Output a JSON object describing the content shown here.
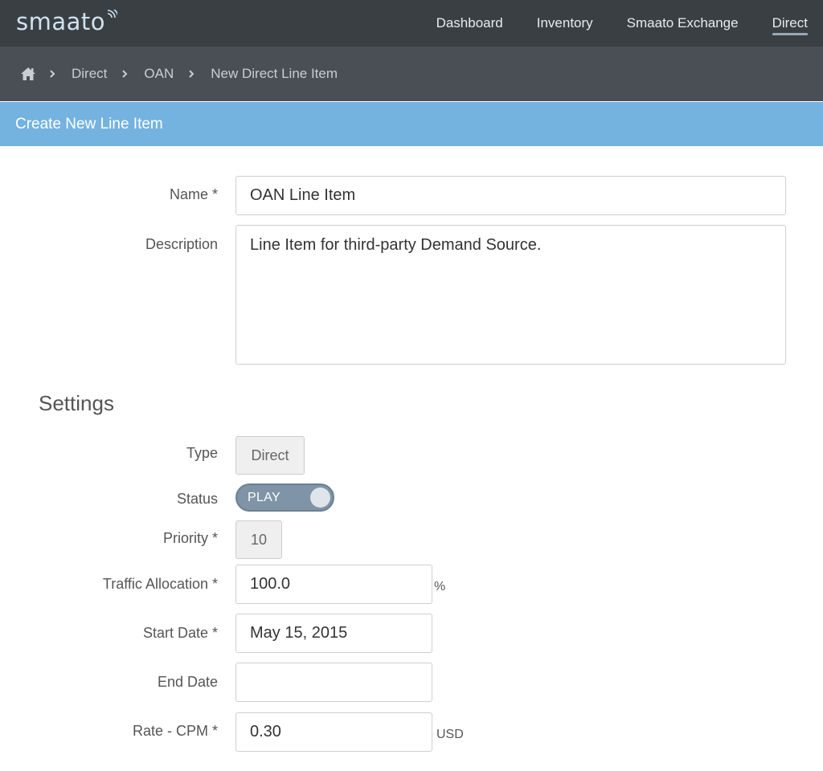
{
  "brand": {
    "logo_text": "smaato"
  },
  "nav": {
    "items": [
      {
        "label": "Dashboard"
      },
      {
        "label": "Inventory"
      },
      {
        "label": "Smaato Exchange"
      },
      {
        "label": "Direct"
      }
    ],
    "active": "Direct"
  },
  "breadcrumb": {
    "items": [
      "Direct",
      "OAN",
      "New Direct Line Item"
    ]
  },
  "panel": {
    "title": "Create New Line Item"
  },
  "form": {
    "name": {
      "label": "Name *",
      "value": "OAN Line Item"
    },
    "description": {
      "label": "Description",
      "value": "Line Item for third-party Demand Source."
    },
    "settings_title": "Settings",
    "type": {
      "label": "Type",
      "value": "Direct"
    },
    "status": {
      "label": "Status",
      "value": "PLAY",
      "on": true
    },
    "priority": {
      "label": "Priority *",
      "value": "10"
    },
    "traffic_allocation": {
      "label": "Traffic Allocation *",
      "value": "100.0",
      "unit": "%"
    },
    "start_date": {
      "label": "Start Date *",
      "value": "May 15, 2015"
    },
    "end_date": {
      "label": "End Date",
      "value": ""
    },
    "rate_cpm": {
      "label": "Rate - CPM *",
      "value": "0.30",
      "unit": "USD"
    }
  },
  "colors": {
    "topbar": "#3a3f44",
    "crumbbar": "#4a4f55",
    "panel_header": "#74b3df",
    "toggle": "#7f94a6"
  },
  "icons": {
    "home": "home-icon",
    "separator": "chevron-right-icon",
    "logo_signal": "signal-icon"
  }
}
